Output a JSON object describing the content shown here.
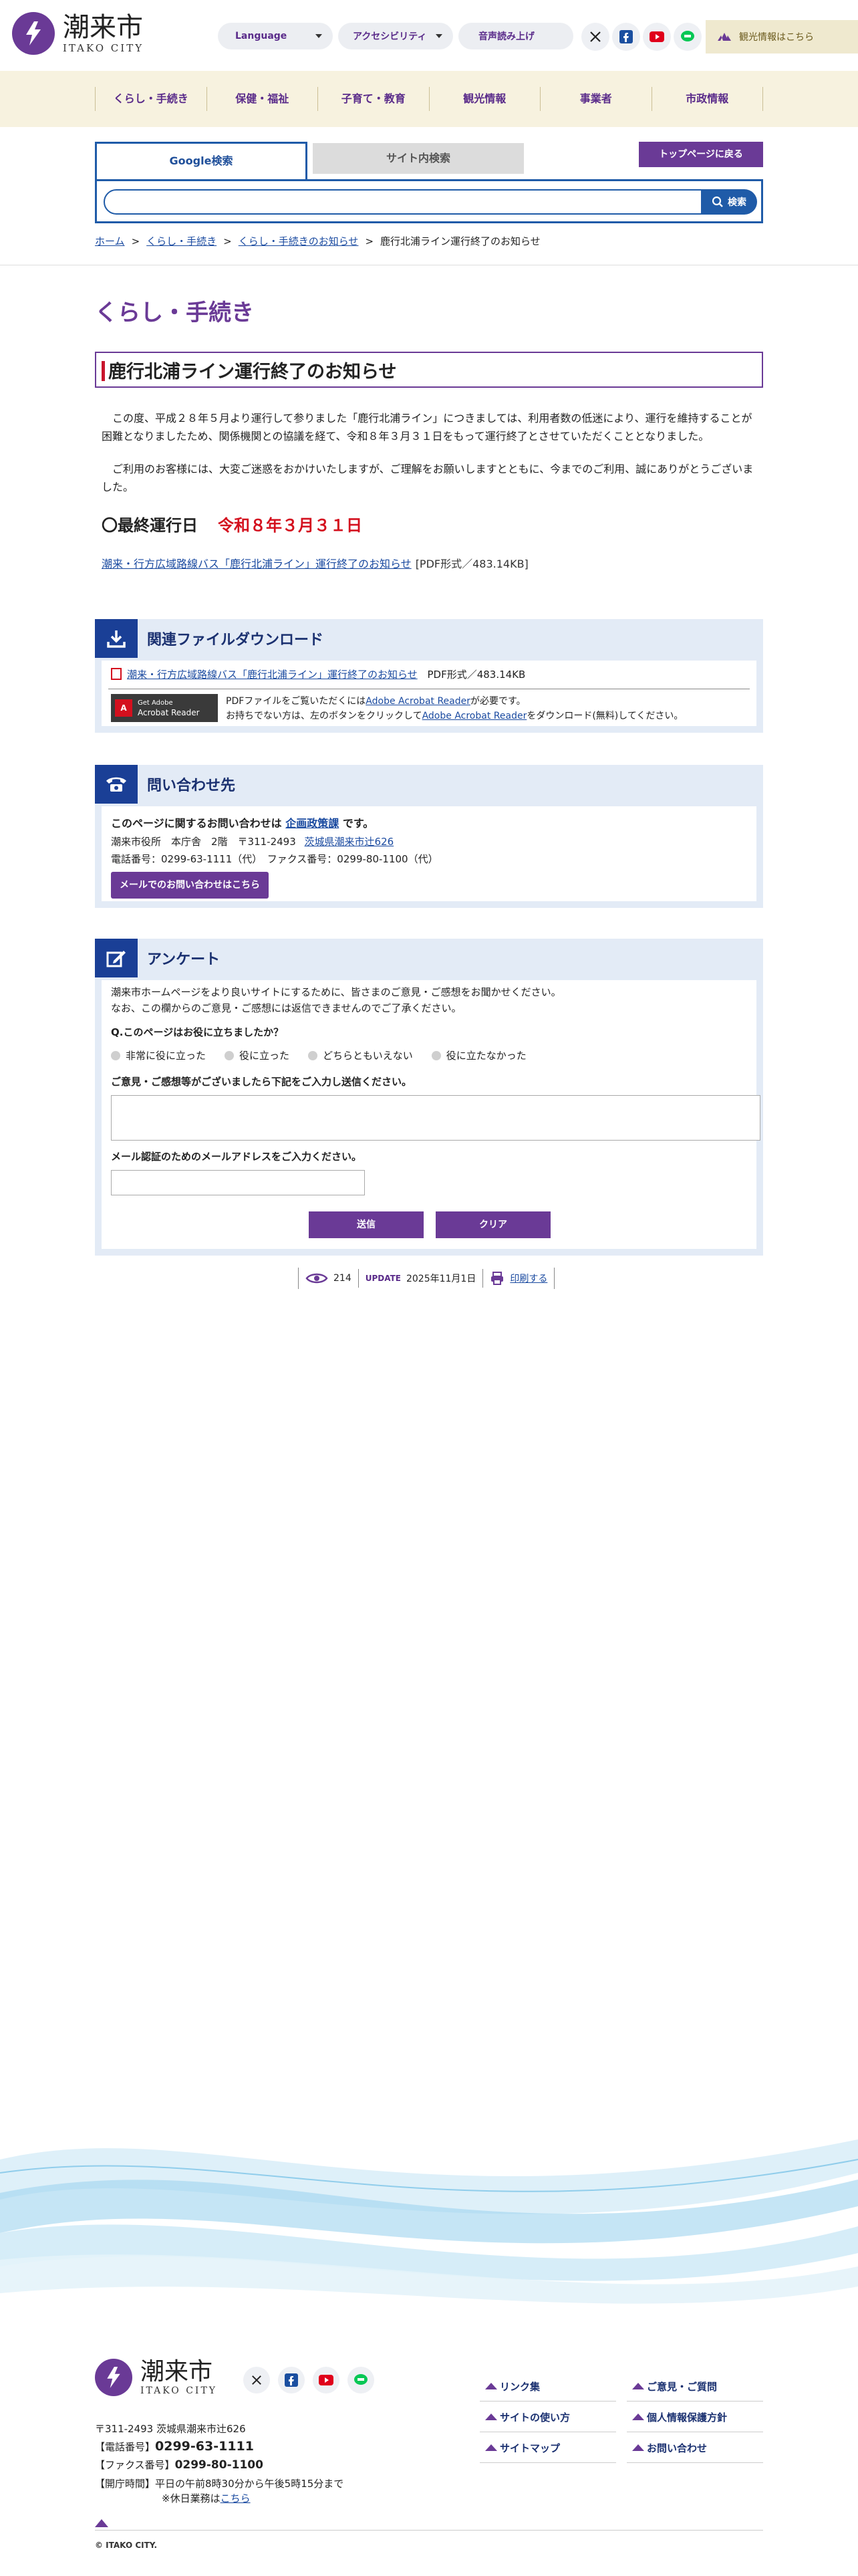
{
  "header": {
    "logo_jp": "潮来市",
    "logo_en": "ITAKO CITY",
    "language": "Language",
    "accessibility": "アクセシビリティ",
    "voice": "音声読み上げ",
    "kanko_label": "観光情報はこちら"
  },
  "nav": [
    "くらし・手続き",
    "保健・福祉",
    "子育て・教育",
    "観光情報",
    "事業者",
    "市政情報"
  ],
  "search": {
    "tab_google": "Google検索",
    "tab_site": "サイト内検索",
    "button": "検索",
    "top_back": "トップページに戻る"
  },
  "breadcrumb": {
    "home": "ホーム",
    "cat": "くらし・手続き",
    "sub": "くらし・手続きのお知らせ",
    "current": "鹿行北浦ライン運行終了のお知らせ",
    "sep": ">"
  },
  "category_title": "くらし・手続き",
  "page_title": "鹿行北浦ライン運行終了のお知らせ",
  "body": {
    "p1": "この度、平成２８年５月より運行して参りました「鹿行北浦ライン」につきましては、利用者数の低迷により、運行を維持することが困難となりましたため、関係機関との協議を経て、令和８年３月３１日をもって運行終了とさせていただくこととなりました。",
    "p2": "ご利用のお客様には、大変ご迷惑をおかけいたしますが、ご理解をお願いしますとともに、今までのご利用、誠にありがとうございました。",
    "lastday_label": "〇最終運行日",
    "lastday_date": "令和８年３月３１日",
    "link_text": "潮来・行方広域路線バス「鹿行北浦ライン」運行終了のお知らせ",
    "link_meta": "[PDF形式／483.14KB]"
  },
  "download": {
    "title": "関連ファイルダウンロード",
    "file_link": "潮来・行方広域路線バス「鹿行北浦ライン」運行終了のお知らせ",
    "file_meta": "PDF形式／483.14KB",
    "acrobat_badge_small": "Get Adobe",
    "acrobat_badge": "Acrobat Reader",
    "note1_a": "PDFファイルをご覧いただくには",
    "note1_link": "Adobe Acrobat Reader",
    "note1_b": "が必要です。",
    "note2_a": "お持ちでない方は、左のボタンをクリックして",
    "note2_link": "Adobe Acrobat Reader",
    "note2_b": "をダウンロード(無料)してください。"
  },
  "contact": {
    "title": "問い合わせ先",
    "lead_a": "このページに関するお問い合わせは",
    "dept": "企画政策課",
    "lead_b": "です。",
    "addr_a": "潮来市役所　本庁舎　2階　〒311-2493",
    "addr_link": "茨城県潮来市辻626",
    "phone": "電話番号：0299-63-1111（代）　ファクス番号：0299-80-1100（代）",
    "mail_btn": "メールでのお問い合わせはこちら"
  },
  "survey": {
    "title": "アンケート",
    "intro1": "潮来市ホームページをより良いサイトにするために、皆さまのご意見・ご感想をお聞かせください。",
    "intro2": "なお、この欄からのご意見・ご感想には返信できませんのでご了承ください。",
    "question": "Q.このページはお役に立ちましたか？",
    "options": [
      "非常に役に立った",
      "役に立った",
      "どちらともいえない",
      "役に立たなかった"
    ],
    "comment_label": "ご意見・ご感想等がございましたら下記をご入力し送信ください。",
    "email_label": "メール認証のためのメールアドレスをご入力ください。",
    "send": "送信",
    "clear": "クリア"
  },
  "stats": {
    "views": "214",
    "update_label": "UPDATE",
    "update_date": "2025年11月1日",
    "print": "印刷する"
  },
  "footer": {
    "zip_addr": "〒311-2493 茨城県潮来市辻626",
    "tel_label": "【電話番号】",
    "tel": "0299-63-1111",
    "fax_label": "【ファクス番号】",
    "fax": "0299-80-1100",
    "hours_label": "【開庁時間】",
    "hours": "平日の午前8時30分から午後5時15分まで",
    "holiday_a": "※休日業務は",
    "holiday_link": "こちら",
    "links": [
      "リンク集",
      "ご意見・ご質問",
      "サイトの使い方",
      "個人情報保護方針",
      "サイトマップ",
      "お問い合わせ"
    ],
    "copyright": "© ITAKO CITY."
  },
  "colors": {
    "brand_purple": "#6a3a96",
    "accent_blue": "#1f5ba8",
    "alert_red": "#d4101e",
    "nav_bg": "#f7f2df"
  }
}
